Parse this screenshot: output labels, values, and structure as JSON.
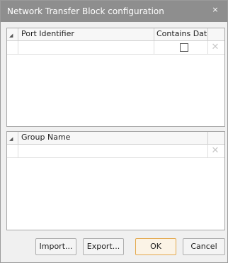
{
  "window": {
    "title": "Network Transfer Block configuration",
    "close_glyph": "×"
  },
  "ports_table": {
    "columns": [
      "Port Identifier",
      "Contains Data"
    ],
    "rows": [
      {
        "port_identifier": "",
        "contains_data": false
      }
    ],
    "delete_glyph": "✕"
  },
  "groups_table": {
    "columns": [
      "Group Name"
    ],
    "rows": [
      {
        "group_name": ""
      }
    ],
    "delete_glyph": "✕"
  },
  "buttons": {
    "import": "Import...",
    "export": "Export...",
    "ok": "OK",
    "cancel": "Cancel"
  }
}
